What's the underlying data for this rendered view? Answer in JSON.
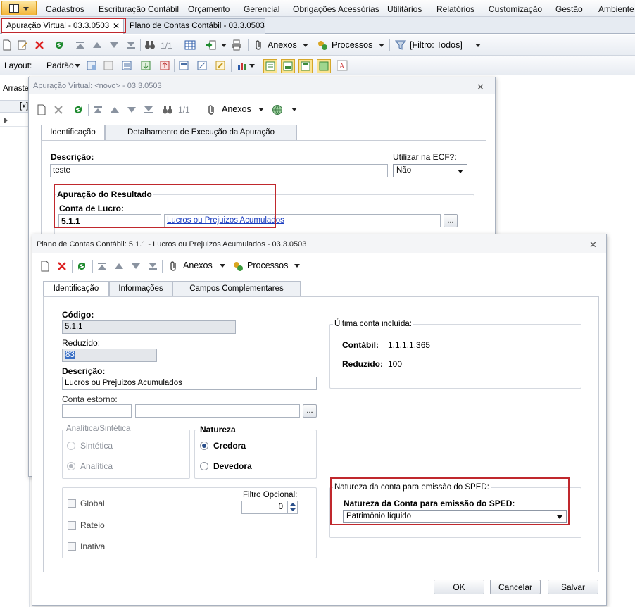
{
  "menu": [
    "Cadastros",
    "Escrituração Contábil",
    "Orçamento",
    "Gerencial",
    "Obrigações Acessórias",
    "Utilitários",
    "Relatórios",
    "Customização",
    "Gestão",
    "Ambiente"
  ],
  "doc_tabs": [
    {
      "label": "Apuração Virtual - 03.3.0503",
      "close": "✕"
    },
    {
      "label": "Plano de Contas Contábil - 03.3.0503"
    }
  ],
  "toolbar1": {
    "pager": "1/1",
    "anexos": "Anexos",
    "processos": "Processos",
    "filtro": "[Filtro: Todos]"
  },
  "toolbar2": {
    "layout_label": "Layout:",
    "layout_value": "Padrão"
  },
  "left_strip": {
    "arraste": "Arraste",
    "col": "[x]"
  },
  "win_apuracao": {
    "title": "Apuração Virtual: <novo> - 03.3.0503",
    "close": "✕",
    "pager": "1/1",
    "anexos": "Anexos",
    "tabs": [
      "Identificação",
      "Detalhamento de Execução da Apuração"
    ],
    "descricao_label": "Descrição:",
    "descricao_value": "teste",
    "ecf_label": "Utilizar na ECF?:",
    "ecf_value": "Não",
    "group_title": "Apuração do Resultado",
    "conta_label": "Conta de Lucro:",
    "conta_value": "5.1.1",
    "conta_desc": "Lucros ou Prejuizos Acumulados",
    "lookup": "..."
  },
  "win_plano": {
    "title": "Plano de Contas Contábil: 5.1.1 - Lucros ou Prejuizos Acumulados - 03.3.0503",
    "close": "✕",
    "anexos": "Anexos",
    "processos": "Processos",
    "tabs": [
      "Identificação",
      "Informações",
      "Campos Complementares"
    ],
    "codigo_label": "Código:",
    "codigo_value": "5.1.1",
    "reduzido_label": "Reduzido:",
    "reduzido_value": "83",
    "descricao_label": "Descrição:",
    "descricao_value": "Lucros ou Prejuizos Acumulados",
    "conta_estorno_label": "Conta estorno:",
    "lookup": "...",
    "analitica_group": "Analítica/Sintética",
    "sintetica": "Sintética",
    "analitica": "Analítica",
    "natureza_group": "Natureza",
    "credora": "Credora",
    "devedora": "Devedora",
    "global": "Global",
    "rateio": "Rateio",
    "inativa": "Inativa",
    "filtro_label": "Filtro Opcional:",
    "filtro_value": "0",
    "ultima_group": "Última conta incluída:",
    "contabil_label": "Contábil:",
    "contabil_value": "1.1.1.1.365",
    "reduzido2_label": "Reduzido:",
    "reduzido2_value": "100",
    "sped_group": "Natureza da conta para emissão do SPED:",
    "sped_label": "Natureza da Conta para emissão do SPED:",
    "sped_value": "Patrimônio líquido",
    "ok": "OK",
    "cancelar": "Cancelar",
    "salvar": "Salvar"
  },
  "colors": {
    "highlight": "#c0282d",
    "link": "#1a3cc0",
    "accent": "#f3b63a"
  }
}
